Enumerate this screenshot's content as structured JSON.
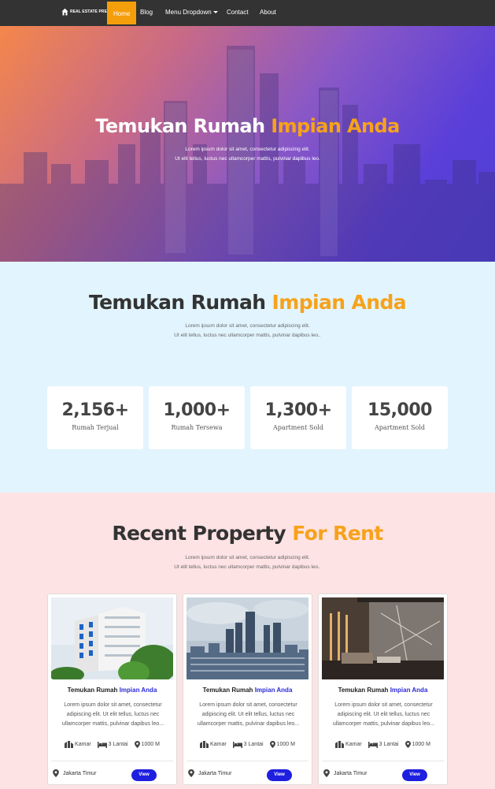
{
  "nav": {
    "brand": "REAL ESTATE PRESS",
    "items": [
      {
        "label": "Home"
      },
      {
        "label": "Blog"
      },
      {
        "label": "Menu Dropdown"
      },
      {
        "label": "Contact"
      },
      {
        "label": "About"
      }
    ]
  },
  "hero": {
    "title_main": "Temukan Rumah",
    "title_accent": "Impian Anda",
    "sub1": "Lorem ipsum dolor sit amet, consectetur adipiscing elit.",
    "sub2": "Ut elit tellus, luctus nec ullamcorper mattis, pulvinar dapibus leo."
  },
  "stats": {
    "title_main": "Temukan Rumah",
    "title_accent": "Impian Anda",
    "sub1": "Lorem ipsum dolor sit amet, consectetur adipiscing elit.",
    "sub2": "Ut elit tellus, luctus nec ullamcorper mattis, pulvinar dapibus leo..",
    "items": [
      {
        "value": "2,156+",
        "label": "Rumah Terjual"
      },
      {
        "value": "1,000+",
        "label": "Rumah Tersewa"
      },
      {
        "value": "1,300+",
        "label": "Apartment Sold"
      },
      {
        "value": "15,000",
        "label": "Apartment Sold"
      }
    ]
  },
  "rent": {
    "title_main": "Recent Property",
    "title_accent": "For Rent",
    "sub1": "Lorem ipsum dolor sit amet, consectetur adipiscing elit.",
    "sub2": "Ut elit tellus, luctus nec ullamcorper mattis, pulvinar dapibus leo..",
    "cards": [
      {
        "title_main": "Temukan Rumah",
        "title_accent": "Impian Anda",
        "desc": "Lorem ipsum dolor sit amet, consectetur adipiscing elit. Ut elit tellus, luctus nec ullamcorper mattis, pulvinar dapibus leo...",
        "kamar": "Kamar",
        "lantai": "3 Lantai",
        "luas": "1000 M",
        "location": "Jakarta Timur",
        "button": "View"
      },
      {
        "title_main": "Temukan Rumah",
        "title_accent": "Impian Anda",
        "desc": "Lorem ipsum dolor sit amet, consectetur adipiscing elit. Ut elit tellus, luctus nec ullamcorper mattis, pulvinar dapibus leo...",
        "kamar": "Kamar",
        "lantai": "3 Lantai",
        "luas": "1000 M",
        "location": "Jakarta Timur",
        "button": "View"
      },
      {
        "title_main": "Temukan Rumah",
        "title_accent": "Impian Anda",
        "desc": "Lorem ipsum dolor sit amet, consectetur adipiscing elit. Ut elit tellus, luctus nec ullamcorper mattis, pulvinar dapibus leo...",
        "kamar": "Kamar",
        "lantai": "3 Lantai",
        "luas": "1000 M",
        "location": "Jakarta Timur",
        "button": "View"
      }
    ]
  },
  "colors": {
    "nav_bg": "#333333",
    "active": "#f59e0b",
    "accent_orange": "#f7a21b",
    "accent_blue": "#2b2bd6",
    "button_blue": "#1f1fe0",
    "stats_bg": "#e2f4fd",
    "rent_bg": "#fde3e3"
  }
}
